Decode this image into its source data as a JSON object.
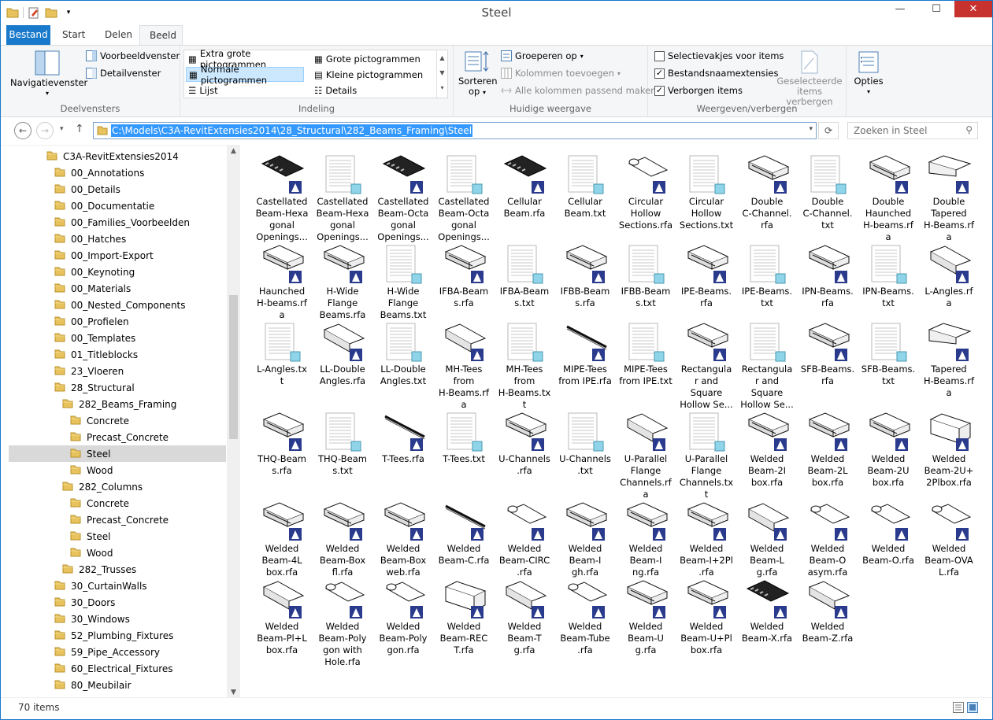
{
  "window": {
    "title": "Steel"
  },
  "titlebar": {
    "minimize": "—",
    "maximize": "☐",
    "close": "✕"
  },
  "tabs": [
    "Bestand",
    "Start",
    "Delen",
    "Beeld"
  ],
  "ribbon": {
    "deelvensters": {
      "label": "Deelvensters",
      "nav_pane": "Navigatievenster",
      "preview": "Voorbeeldvenster",
      "details": "Detailvenster"
    },
    "indeling": {
      "label": "Indeling",
      "items": [
        "Extra grote pictogrammen",
        "Grote pictogrammen",
        "Normale pictogrammen",
        "Kleine pictogrammen",
        "Lijst",
        "Details"
      ],
      "selected": "Normale pictogrammen"
    },
    "huidige": {
      "label": "Huidige weergave",
      "sort_line1": "Sorteren",
      "sort_line2": "op",
      "group": "Groeperen op",
      "add_cols": "Kolommen toevoegen",
      "fit_cols": "Alle kolommen passend maken"
    },
    "weergeven": {
      "label": "Weergeven/verbergen",
      "checkboxes": [
        "Selectievakjes voor items",
        "Bestandsnaamextensies",
        "Verborgen items"
      ],
      "checked": [
        false,
        true,
        true
      ],
      "hide_sel_line1": "Geselecteerde",
      "hide_sel_line2": "items verbergen"
    },
    "opties": {
      "label": "Opties"
    }
  },
  "address": {
    "path": "C:\\Models\\C3A-RevitExtensies2014\\28_Structural\\282_Beams_Framing\\Steel"
  },
  "search": {
    "placeholder": "Zoeken in Steel"
  },
  "tree": [
    {
      "label": "C3A-RevitExtensies2014",
      "level": 0
    },
    {
      "label": "00_Annotations",
      "level": 1
    },
    {
      "label": "00_Details",
      "level": 1
    },
    {
      "label": "00_Documentatie",
      "level": 1
    },
    {
      "label": "00_Families_Voorbeelden",
      "level": 1
    },
    {
      "label": "00_Hatches",
      "level": 1
    },
    {
      "label": "00_Import-Export",
      "level": 1
    },
    {
      "label": "00_Keynoting",
      "level": 1
    },
    {
      "label": "00_Materials",
      "level": 1
    },
    {
      "label": "00_Nested_Components",
      "level": 1
    },
    {
      "label": "00_Profielen",
      "level": 1
    },
    {
      "label": "00_Templates",
      "level": 1
    },
    {
      "label": "01_Titleblocks",
      "level": 1
    },
    {
      "label": "23_Vloeren",
      "level": 1
    },
    {
      "label": "28_Structural",
      "level": 1
    },
    {
      "label": "282_Beams_Framing",
      "level": 2
    },
    {
      "label": "Concrete",
      "level": 3
    },
    {
      "label": "Precast_Concrete",
      "level": 3
    },
    {
      "label": "Steel",
      "level": 3,
      "selected": true
    },
    {
      "label": "Wood",
      "level": 3
    },
    {
      "label": "282_Columns",
      "level": 2
    },
    {
      "label": "Concrete",
      "level": 3
    },
    {
      "label": "Precast_Concrete",
      "level": 3
    },
    {
      "label": "Steel",
      "level": 3
    },
    {
      "label": "Wood",
      "level": 3
    },
    {
      "label": "282_Trusses",
      "level": 2
    },
    {
      "label": "30_CurtainWalls",
      "level": 1
    },
    {
      "label": "30_Doors",
      "level": 1
    },
    {
      "label": "30_Windows",
      "level": 1
    },
    {
      "label": "52_Plumbing_Fixtures",
      "level": 1
    },
    {
      "label": "59_Pipe_Accessory",
      "level": 1
    },
    {
      "label": "60_Electrical_Fixtures",
      "level": 1
    },
    {
      "label": "80_Meubilair",
      "level": 1
    }
  ],
  "files": [
    {
      "name": "Castellated\nBeam-Hexa\ngonal\nOpenings...",
      "type": "rfa",
      "shape": "castellated"
    },
    {
      "name": "Castellated\nBeam-Hexa\ngonal\nOpenings...",
      "type": "txt"
    },
    {
      "name": "Castellated\nBeam-Octa\ngonal\nOpenings...",
      "type": "rfa",
      "shape": "castellated"
    },
    {
      "name": "Castellated\nBeam-Octa\ngonal\nOpenings...",
      "type": "txt"
    },
    {
      "name": "Cellular\nBeam.rfa",
      "type": "rfa",
      "shape": "castellated"
    },
    {
      "name": "Cellular\nBeam.txt",
      "type": "txt"
    },
    {
      "name": "Circular\nHollow\nSections.rfa",
      "type": "rfa",
      "shape": "tube"
    },
    {
      "name": "Circular\nHollow\nSections.txt",
      "type": "txt"
    },
    {
      "name": "Double\nC-Channel.\nrfa",
      "type": "rfa",
      "shape": "ibeam"
    },
    {
      "name": "Double\nC-Channel.\ntxt",
      "type": "txt"
    },
    {
      "name": "Double\nHaunched\nH-beams.rf\na",
      "type": "rfa",
      "shape": "ibeam"
    },
    {
      "name": "Double\nTapered\nH-Beams.rf\na",
      "type": "rfa",
      "shape": "tapered"
    },
    {
      "name": "Haunched\nH-beams.rf\na",
      "type": "rfa",
      "shape": "ibeam"
    },
    {
      "name": "H-Wide\nFlange\nBeams.rfa",
      "type": "rfa",
      "shape": "ibeam"
    },
    {
      "name": "H-Wide\nFlange\nBeams.txt",
      "type": "txt"
    },
    {
      "name": "IFBA-Beam\ns.rfa",
      "type": "rfa",
      "shape": "ibeam"
    },
    {
      "name": "IFBA-Beam\ns.txt",
      "type": "txt"
    },
    {
      "name": "IFBB-Beam\ns.rfa",
      "type": "rfa",
      "shape": "ibeam"
    },
    {
      "name": "IFBB-Beam\ns.txt",
      "type": "txt"
    },
    {
      "name": "IPE-Beams.\nrfa",
      "type": "rfa",
      "shape": "ibeam"
    },
    {
      "name": "IPE-Beams.\ntxt",
      "type": "txt"
    },
    {
      "name": "IPN-Beams.\nrfa",
      "type": "rfa",
      "shape": "ibeam"
    },
    {
      "name": "IPN-Beams.\ntxt",
      "type": "txt"
    },
    {
      "name": "L-Angles.rf\na",
      "type": "rfa",
      "shape": "angle"
    },
    {
      "name": "L-Angles.tx\nt",
      "type": "txt"
    },
    {
      "name": "LL-Double\nAngles.rfa",
      "type": "rfa",
      "shape": "angle"
    },
    {
      "name": "LL-Double\nAngles.txt",
      "type": "txt"
    },
    {
      "name": "MH-Tees\nfrom\nH-Beams.rf\na",
      "type": "rfa",
      "shape": "angle"
    },
    {
      "name": "MH-Tees\nfrom\nH-Beams.tx\nt",
      "type": "txt"
    },
    {
      "name": "MIPE-Tees\nfrom IPE.rfa",
      "type": "rfa",
      "shape": "thin"
    },
    {
      "name": "MIPE-Tees\nfrom IPE.txt",
      "type": "txt"
    },
    {
      "name": "Rectangula\nr and\nSquare\nHollow Se...",
      "type": "rfa",
      "shape": "ibeam"
    },
    {
      "name": "Rectangula\nr and\nSquare\nHollow Se...",
      "type": "txt"
    },
    {
      "name": "SFB-Beams.\nrfa",
      "type": "rfa",
      "shape": "ibeam"
    },
    {
      "name": "SFB-Beams.\ntxt",
      "type": "txt"
    },
    {
      "name": "Tapered\nH-Beams.rf\na",
      "type": "rfa",
      "shape": "tapered"
    },
    {
      "name": "THQ-Beam\ns.rfa",
      "type": "rfa",
      "shape": "ibeam"
    },
    {
      "name": "THQ-Beam\ns.txt",
      "type": "txt"
    },
    {
      "name": "T-Tees.rfa",
      "type": "rfa",
      "shape": "thin"
    },
    {
      "name": "T-Tees.txt",
      "type": "txt"
    },
    {
      "name": "U-Channels\n.rfa",
      "type": "rfa",
      "shape": "ibeam"
    },
    {
      "name": "U-Channels\n.txt",
      "type": "txt"
    },
    {
      "name": "U-Parallel\nFlange\nChannels.rf\na",
      "type": "rfa",
      "shape": "angle"
    },
    {
      "name": "U-Parallel\nFlange\nChannels.tx\nt",
      "type": "txt"
    },
    {
      "name": "Welded\nBeam-2I\nbox.rfa",
      "type": "rfa",
      "shape": "ibeam"
    },
    {
      "name": "Welded\nBeam-2L\nbox.rfa",
      "type": "rfa",
      "shape": "ibeam"
    },
    {
      "name": "Welded\nBeam-2U\nbox.rfa",
      "type": "rfa",
      "shape": "ibeam"
    },
    {
      "name": "Welded\nBeam-2U+\n2Plbox.rfa",
      "type": "rfa",
      "shape": "box"
    },
    {
      "name": "Welded\nBeam-4L\nbox.rfa",
      "type": "rfa",
      "shape": "ibeam"
    },
    {
      "name": "Welded\nBeam-Box\nfl.rfa",
      "type": "rfa",
      "shape": "ibeam"
    },
    {
      "name": "Welded\nBeam-Box\nweb.rfa",
      "type": "rfa",
      "shape": "ibeam"
    },
    {
      "name": "Welded\nBeam-C.rfa",
      "type": "rfa",
      "shape": "thin"
    },
    {
      "name": "Welded\nBeam-CIRC\n.rfa",
      "type": "rfa",
      "shape": "tube"
    },
    {
      "name": "Welded\nBeam-I\ngh.rfa",
      "type": "rfa",
      "shape": "ibeam"
    },
    {
      "name": "Welded\nBeam-I\nng.rfa",
      "type": "rfa",
      "shape": "ibeam"
    },
    {
      "name": "Welded\nBeam-I+2Pl\n.rfa",
      "type": "rfa",
      "shape": "ibeam"
    },
    {
      "name": "Welded\nBeam-L\ng.rfa",
      "type": "rfa",
      "shape": "angle"
    },
    {
      "name": "Welded\nBeam-O\nasym.rfa",
      "type": "rfa",
      "shape": "tube"
    },
    {
      "name": "Welded\nBeam-O.rfa",
      "type": "rfa",
      "shape": "tube"
    },
    {
      "name": "Welded\nBeam-OVA\nL.rfa",
      "type": "rfa",
      "shape": "tube"
    },
    {
      "name": "Welded\nBeam-Pl+L\nbox.rfa",
      "type": "rfa",
      "shape": "angle"
    },
    {
      "name": "Welded\nBeam-Poly\ngon with\nHole.rfa",
      "type": "rfa",
      "shape": "tube"
    },
    {
      "name": "Welded\nBeam-Poly\ngon.rfa",
      "type": "rfa",
      "shape": "tube"
    },
    {
      "name": "Welded\nBeam-REC\nT.rfa",
      "type": "rfa",
      "shape": "box"
    },
    {
      "name": "Welded\nBeam-T\ng.rfa",
      "type": "rfa",
      "shape": "angle"
    },
    {
      "name": "Welded\nBeam-Tube\n.rfa",
      "type": "rfa",
      "shape": "tube"
    },
    {
      "name": "Welded\nBeam-U\ng.rfa",
      "type": "rfa",
      "shape": "ibeam"
    },
    {
      "name": "Welded\nBeam-U+Pl\nbox.rfa",
      "type": "rfa",
      "shape": "ibeam"
    },
    {
      "name": "Welded\nBeam-X.rfa",
      "type": "rfa",
      "shape": "castellated"
    },
    {
      "name": "Welded\nBeam-Z.rfa",
      "type": "rfa",
      "shape": "angle"
    }
  ],
  "status": {
    "count": "70 items"
  },
  "colors": {
    "accent": "#1979ca",
    "selection": "#cce8ff",
    "path_highlight": "#3399ff",
    "close": "#c7312e"
  }
}
